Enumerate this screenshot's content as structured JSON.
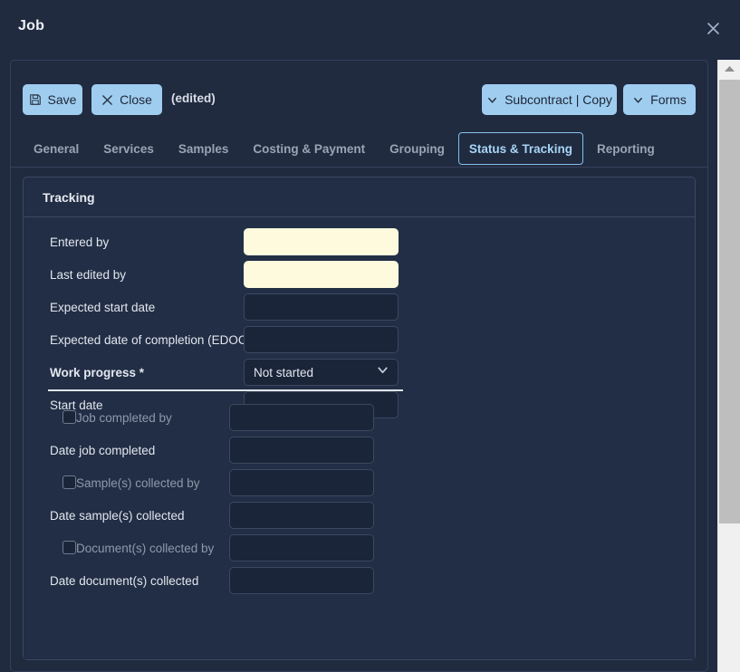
{
  "window": {
    "title": "Job",
    "close_icon": "close-icon"
  },
  "scrollbar": {
    "up_icon": "scroll-up-arrow-icon"
  },
  "toolbar": {
    "save_label": "Save",
    "save_icon": "floppy-disk-icon",
    "close_label": "Close",
    "close_icon": "x-icon",
    "edited_note": "(edited)",
    "subcontract_label": "Subcontract | Copy",
    "subcontract_icon": "chevron-down-icon",
    "forms_label": "Forms",
    "forms_icon": "chevron-down-icon"
  },
  "tabs": [
    {
      "label": "General",
      "active": false
    },
    {
      "label": "Services",
      "active": false
    },
    {
      "label": "Samples",
      "active": false
    },
    {
      "label": "Costing & Payment",
      "active": false
    },
    {
      "label": "Grouping",
      "active": false
    },
    {
      "label": "Status & Tracking",
      "active": true
    },
    {
      "label": "Reporting",
      "active": false
    }
  ],
  "card": {
    "title": "Tracking"
  },
  "form": {
    "rows": [
      {
        "label": "Entered by",
        "value": "",
        "style": "yellow",
        "bold": false,
        "checkbox": false
      },
      {
        "label": "Last edited by",
        "value": "",
        "style": "yellow",
        "bold": false,
        "checkbox": false
      },
      {
        "label": "Expected start date",
        "value": "",
        "style": "dark",
        "bold": false,
        "checkbox": false
      },
      {
        "label": "Expected date of completion (EDOC)",
        "value": "",
        "style": "dark",
        "bold": false,
        "checkbox": false
      },
      {
        "label": "Work progress *",
        "value": "Not started",
        "style": "select",
        "bold": true,
        "checkbox": false
      },
      {
        "label": "Start date",
        "value": "",
        "style": "dark",
        "bold": false,
        "checkbox": false
      }
    ],
    "checkbox_rows": [
      {
        "label": "Job completed by",
        "value": "",
        "checkbox": true,
        "checked": false,
        "dim": true
      },
      {
        "label": "Date job completed",
        "value": "",
        "checkbox": false,
        "checked": false,
        "dim": false
      },
      {
        "label": "Sample(s) collected by",
        "value": "",
        "checkbox": true,
        "checked": false,
        "dim": true
      },
      {
        "label": "Date sample(s) collected",
        "value": "",
        "checkbox": false,
        "checked": false,
        "dim": false
      },
      {
        "label": "Document(s) collected by",
        "value": "",
        "checkbox": true,
        "checked": false,
        "dim": true
      },
      {
        "label": "Date document(s) collected",
        "value": "",
        "checkbox": false,
        "checked": false,
        "dim": false
      }
    ],
    "work_progress_icon": "chevron-down-icon"
  },
  "colors": {
    "background": "#202b40",
    "card": "#222e45",
    "accent_button": "#9fcdf0",
    "active_tab_text": "#a8d4f5",
    "active_tab_border": "#86c0ec",
    "required_field": "#fdfadd",
    "input_dark": "#1b2539",
    "border": "#3c4761"
  }
}
